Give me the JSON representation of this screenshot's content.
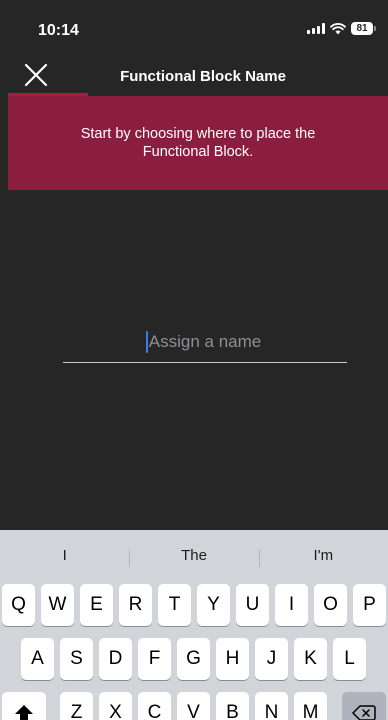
{
  "status_bar": {
    "time": "10:14",
    "battery": "81"
  },
  "header": {
    "title": "Functional Block Name",
    "close_icon": "close-icon"
  },
  "banner": {
    "text": "Start by choosing where to place the Functional Block.",
    "color": "#8b1e3f"
  },
  "name_field": {
    "placeholder": "Assign a name",
    "value": ""
  },
  "keyboard": {
    "suggestions": [
      "I",
      "The",
      "I'm"
    ],
    "row1": [
      "Q",
      "W",
      "E",
      "R",
      "T",
      "Y",
      "U",
      "I",
      "O",
      "P"
    ],
    "row2": [
      "A",
      "S",
      "D",
      "F",
      "G",
      "H",
      "J",
      "K",
      "L"
    ],
    "row3": [
      "Z",
      "X",
      "C",
      "V",
      "B",
      "N",
      "M"
    ],
    "shift_icon": "shift-icon",
    "delete_icon": "backspace-icon"
  }
}
